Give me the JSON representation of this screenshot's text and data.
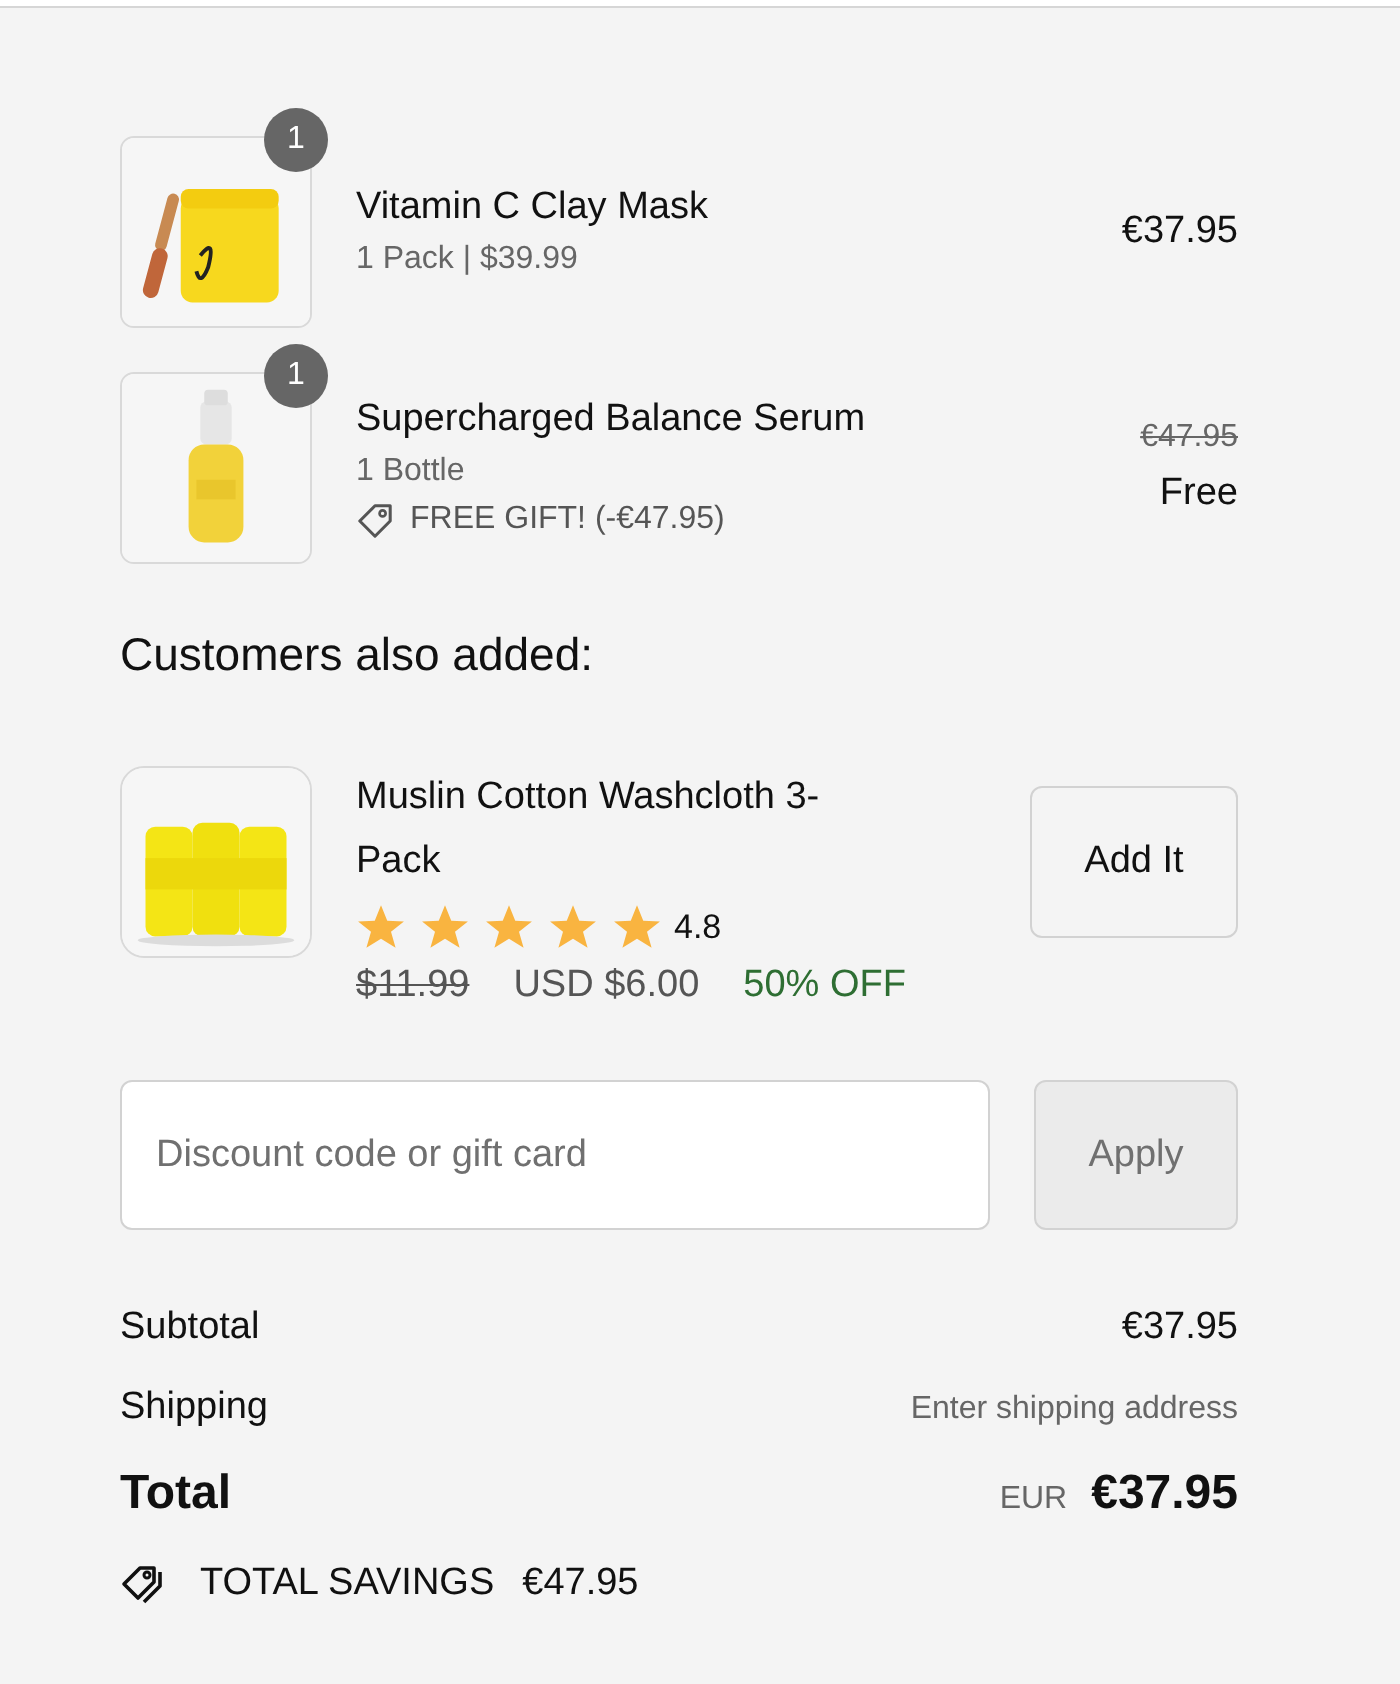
{
  "cart_items": [
    {
      "quantity": "1",
      "name": "Vitamin C Clay Mask",
      "variant": "1 Pack | $39.99",
      "price": "€37.95"
    },
    {
      "quantity": "1",
      "name": "Supercharged Balance Serum",
      "variant": "1 Bottle",
      "discount": "FREE GIFT! (-€47.95)",
      "compare_price": "€47.95",
      "price": "Free"
    }
  ],
  "upsell": {
    "heading": "Customers also added:",
    "product": {
      "name": "Muslin Cotton Washcloth 3-Pack",
      "stars": 5,
      "rating": "4.8",
      "compare_price": "$11.99",
      "price": "USD $6.00",
      "badge": "50% OFF",
      "button": "Add It"
    }
  },
  "discount": {
    "placeholder": "Discount code or gift card",
    "button": "Apply"
  },
  "summary": {
    "subtotal_label": "Subtotal",
    "subtotal": "€37.95",
    "shipping_label": "Shipping",
    "shipping": "Enter shipping address",
    "total_label": "Total",
    "currency": "EUR",
    "total": "€37.95",
    "savings_label": "TOTAL SAVINGS",
    "savings": "€47.95"
  }
}
